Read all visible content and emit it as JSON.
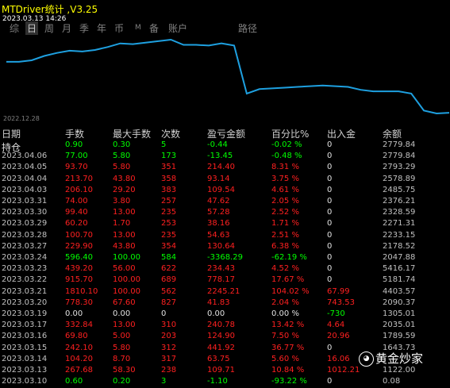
{
  "header": {
    "title": "MTDriver统计 ,V3.25",
    "datetime": "2023.03.13 14:26"
  },
  "tabs": [
    {
      "label": "综",
      "active": false
    },
    {
      "label": "日",
      "active": true
    },
    {
      "label": "周",
      "active": false
    },
    {
      "label": "月",
      "active": false
    },
    {
      "label": "季",
      "active": false
    },
    {
      "label": "年",
      "active": false
    },
    {
      "label": "币",
      "active": false
    },
    {
      "label": "M",
      "active": false
    },
    {
      "label": "备",
      "active": false
    },
    {
      "label": "账户",
      "active": false
    },
    {
      "label": "路径",
      "active": false
    }
  ],
  "chart_data": {
    "type": "line",
    "start_label": "2022.12.28",
    "line_color": "#1ea0e0",
    "y": [
      0.3,
      0.3,
      0.28,
      0.22,
      0.18,
      0.15,
      0.16,
      0.14,
      0.1,
      0.05,
      0.06,
      0.04,
      0.02,
      0.0,
      0.07,
      0.07,
      0.08,
      0.05,
      0.08,
      0.73,
      0.67,
      0.66,
      0.65,
      0.64,
      0.63,
      0.62,
      0.63,
      0.64,
      0.68,
      0.7,
      0.7,
      0.7,
      0.73,
      0.96,
      1.0,
      0.99
    ]
  },
  "columns": [
    "日期",
    "手数",
    "最大手数",
    "次数",
    "盈亏金额",
    "百分比%",
    "出入金",
    "余额"
  ],
  "rows": [
    {
      "date": "持仓",
      "lots": "0.90",
      "max": "0.30",
      "count": "5",
      "pnl": "-0.44",
      "pct": "-0.02 %",
      "io": "0",
      "bal": "2779.84",
      "c": "g",
      "ioc": "w"
    },
    {
      "date": "2023.04.06",
      "lots": "77.00",
      "max": "5.80",
      "count": "173",
      "pnl": "-13.45",
      "pct": "-0.48 %",
      "io": "0",
      "bal": "2779.84",
      "c": "g",
      "ioc": "w"
    },
    {
      "date": "2023.04.05",
      "lots": "93.70",
      "max": "5.80",
      "count": "351",
      "pnl": "214.40",
      "pct": "8.31 %",
      "io": "0",
      "bal": "2793.29",
      "c": "r",
      "ioc": "w"
    },
    {
      "date": "2023.04.04",
      "lots": "213.70",
      "max": "43.80",
      "count": "358",
      "pnl": "93.14",
      "pct": "3.75 %",
      "io": "0",
      "bal": "2578.89",
      "c": "r",
      "ioc": "w"
    },
    {
      "date": "2023.04.03",
      "lots": "206.10",
      "max": "29.20",
      "count": "383",
      "pnl": "109.54",
      "pct": "4.61 %",
      "io": "0",
      "bal": "2485.75",
      "c": "r",
      "ioc": "w"
    },
    {
      "date": "2023.03.31",
      "lots": "74.00",
      "max": "3.80",
      "count": "257",
      "pnl": "47.62",
      "pct": "2.05 %",
      "io": "0",
      "bal": "2376.21",
      "c": "r",
      "ioc": "w"
    },
    {
      "date": "2023.03.30",
      "lots": "99.40",
      "max": "13.00",
      "count": "235",
      "pnl": "57.28",
      "pct": "2.52 %",
      "io": "0",
      "bal": "2328.59",
      "c": "r",
      "ioc": "w"
    },
    {
      "date": "2023.03.29",
      "lots": "60.20",
      "max": "1.70",
      "count": "253",
      "pnl": "38.16",
      "pct": "1.71 %",
      "io": "0",
      "bal": "2271.31",
      "c": "r",
      "ioc": "w"
    },
    {
      "date": "2023.03.28",
      "lots": "100.70",
      "max": "13.00",
      "count": "235",
      "pnl": "54.63",
      "pct": "2.51 %",
      "io": "0",
      "bal": "2233.15",
      "c": "r",
      "ioc": "w"
    },
    {
      "date": "2023.03.27",
      "lots": "229.90",
      "max": "43.80",
      "count": "354",
      "pnl": "130.64",
      "pct": "6.38 %",
      "io": "0",
      "bal": "2178.52",
      "c": "r",
      "ioc": "w"
    },
    {
      "date": "2023.03.24",
      "lots": "596.40",
      "max": "100.00",
      "count": "584",
      "pnl": "-3368.29",
      "pct": "-62.19 %",
      "io": "0",
      "bal": "2047.88",
      "c": "g",
      "ioc": "w"
    },
    {
      "date": "2023.03.23",
      "lots": "439.20",
      "max": "56.00",
      "count": "622",
      "pnl": "234.43",
      "pct": "4.52 %",
      "io": "0",
      "bal": "5416.17",
      "c": "r",
      "ioc": "w"
    },
    {
      "date": "2023.03.22",
      "lots": "915.70",
      "max": "100.00",
      "count": "689",
      "pnl": "778.17",
      "pct": "17.67 %",
      "io": "0",
      "bal": "5181.74",
      "c": "r",
      "ioc": "w"
    },
    {
      "date": "2023.03.21",
      "lots": "1810.10",
      "max": "100.00",
      "count": "562",
      "pnl": "2245.21",
      "pct": "104.02 %",
      "io": "67.99",
      "bal": "4403.57",
      "c": "r",
      "ioc": "r"
    },
    {
      "date": "2023.03.20",
      "lots": "778.30",
      "max": "67.60",
      "count": "827",
      "pnl": "41.83",
      "pct": "2.04 %",
      "io": "743.53",
      "bal": "2090.37",
      "c": "r",
      "ioc": "r"
    },
    {
      "date": "2023.03.19",
      "lots": "0.00",
      "max": "0.00",
      "count": "0",
      "pnl": "0.00",
      "pct": "0.00 %",
      "io": "-730",
      "bal": "1305.01",
      "c": "w",
      "ioc": "g"
    },
    {
      "date": "2023.03.17",
      "lots": "332.84",
      "max": "13.00",
      "count": "310",
      "pnl": "240.78",
      "pct": "13.42 %",
      "io": "4.64",
      "bal": "2035.01",
      "c": "r",
      "ioc": "r"
    },
    {
      "date": "2023.03.16",
      "lots": "69.80",
      "max": "5.00",
      "count": "203",
      "pnl": "124.90",
      "pct": "7.50 %",
      "io": "20.96",
      "bal": "1789.59",
      "c": "r",
      "ioc": "r"
    },
    {
      "date": "2023.03.15",
      "lots": "242.10",
      "max": "5.80",
      "count": "312",
      "pnl": "441.92",
      "pct": "36.77 %",
      "io": "0",
      "bal": "1643.73",
      "c": "r",
      "ioc": "w"
    },
    {
      "date": "2023.03.14",
      "lots": "104.20",
      "max": "8.70",
      "count": "317",
      "pnl": "63.75",
      "pct": "5.60 %",
      "io": "16.06",
      "bal": "",
      "c": "r",
      "ioc": "r"
    },
    {
      "date": "2023.03.13",
      "lots": "267.68",
      "max": "58.30",
      "count": "238",
      "pnl": "109.71",
      "pct": "10.84 %",
      "io": "1012.21",
      "bal": "1122.00",
      "c": "r",
      "ioc": "r"
    },
    {
      "date": "2023.03.10",
      "lots": "0.60",
      "max": "0.20",
      "count": "3",
      "pnl": "-1.10",
      "pct": "-93.22 %",
      "io": "0",
      "bal": "0.08",
      "c": "g",
      "ioc": "w"
    }
  ],
  "watermark": {
    "icon": "wechat-icon",
    "text": "黄金炒家"
  }
}
